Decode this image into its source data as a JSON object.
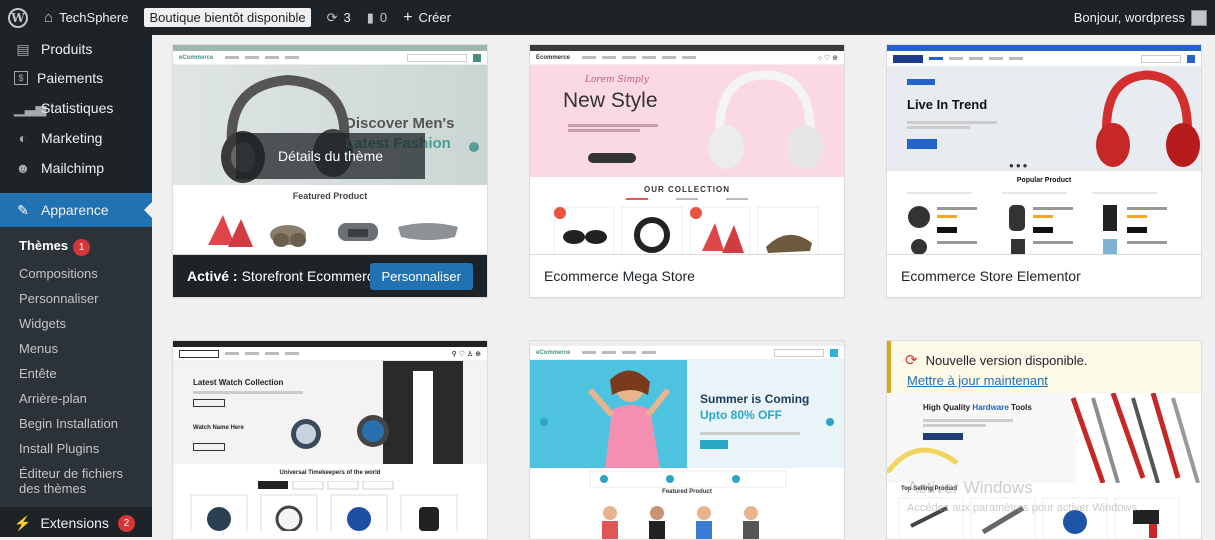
{
  "adminbar": {
    "site_name": "TechSphere",
    "store_badge": "Boutique bientôt disponible",
    "updates_count": "3",
    "comments_count": "0",
    "create_label": "Créer",
    "greeting": "Bonjour, wordpress"
  },
  "sidebar": {
    "items": [
      {
        "label": "Produits",
        "icon": "products-icon"
      },
      {
        "label": "Paiements",
        "icon": "payments-icon"
      },
      {
        "label": "Statistiques",
        "icon": "stats-icon"
      },
      {
        "label": "Marketing",
        "icon": "marketing-icon"
      },
      {
        "label": "Mailchimp",
        "icon": "mailchimp-icon"
      }
    ],
    "active": {
      "label": "Apparence",
      "icon": "appearance-icon"
    },
    "submenu": [
      {
        "label": "Thèmes",
        "badge": "1"
      },
      {
        "label": "Compositions"
      },
      {
        "label": "Personnaliser"
      },
      {
        "label": "Widgets"
      },
      {
        "label": "Menus"
      },
      {
        "label": "Entête"
      },
      {
        "label": "Arrière-plan"
      },
      {
        "label": "Begin Installation"
      },
      {
        "label": "Install Plugins"
      },
      {
        "label": "Éditeur de fichiers des thèmes"
      }
    ],
    "extensions": {
      "label": "Extensions",
      "badge": "2"
    }
  },
  "themes": {
    "active": {
      "prefix": "Activé :",
      "name": "Storefront Ecommerce Sh...",
      "customize_label": "Personnaliser",
      "details_label": "Détails du thème",
      "hero_line1": "Discover Men's",
      "hero_line2": "Latest Fashion",
      "section": "Featured Product",
      "logo": "eCommerce"
    },
    "mega": {
      "name": "Ecommerce Mega Store",
      "logo": "Ecommerce",
      "script": "Lorem Simply",
      "hero": "New Style",
      "section": "OUR COLLECTION"
    },
    "elementor": {
      "name": "Ecommerce Store Elementor",
      "hero": "Live In Trend",
      "section": "Popular Product"
    },
    "watch": {
      "hero": "Latest Watch Collection",
      "badge": "Watch Name Here",
      "section": "Universal Timekeepers of the world"
    },
    "summer": {
      "line1": "Summer is Coming",
      "line2": "Upto 80% OFF",
      "section": "Featured Product",
      "logo": "eCommerce"
    },
    "hardware": {
      "notice": "Nouvelle version disponible.",
      "update_link": "Mettre à jour maintenant",
      "hero_pre": "High Quality ",
      "hero_hl": "Hardware",
      "hero_post": " Tools",
      "section": "Top Selling Product"
    }
  },
  "watermark": {
    "line1": "Activer Windows",
    "line2": "Accédez aux paramètres pour activer Windows."
  }
}
